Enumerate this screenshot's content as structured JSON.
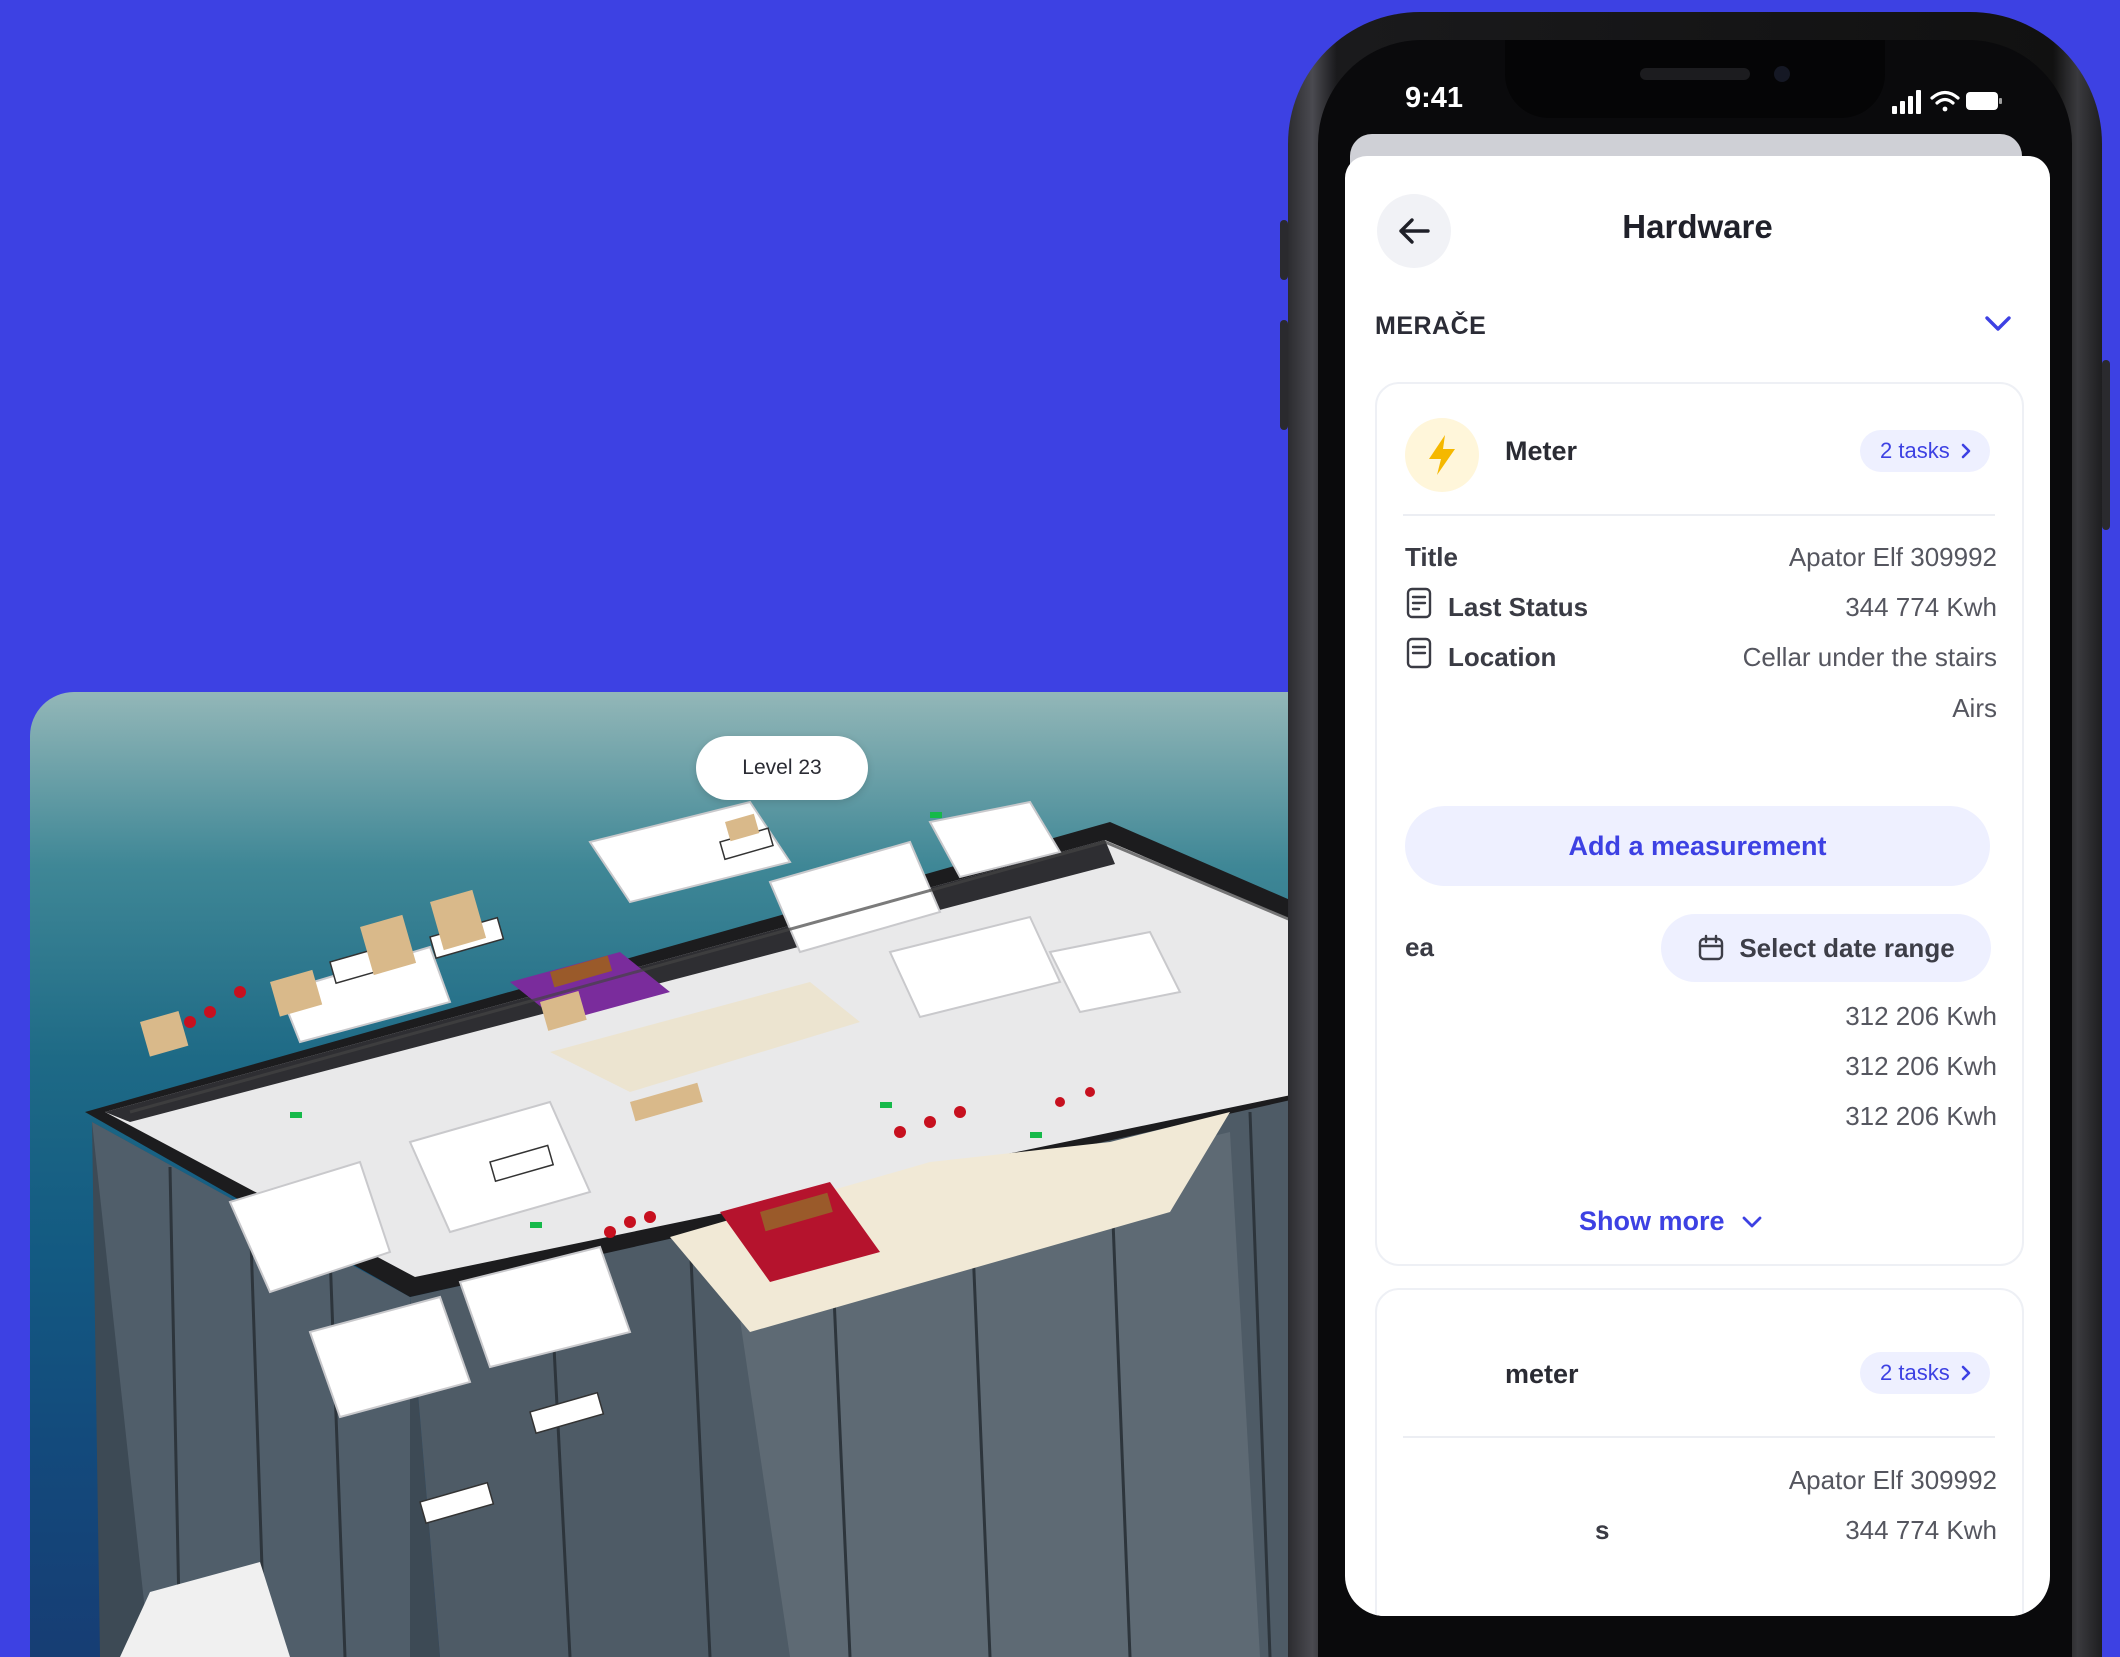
{
  "status_bar": {
    "time": "9:41"
  },
  "header": {
    "title": "Hardware"
  },
  "section": {
    "label": "MERAČE"
  },
  "meter_card": {
    "name": "Meter",
    "tasks": "2 tasks",
    "rows": [
      {
        "label": "Title",
        "value": "Apator Elf 309992"
      },
      {
        "label": "Last Status",
        "value": "344 774 Kwh"
      },
      {
        "label": "Location",
        "value": "Cellar under the stairs"
      },
      {
        "label": "",
        "value": "Airs"
      }
    ],
    "add_measurement": "Add a measurement",
    "area_label": "ea",
    "date_range": "Select date range",
    "readings": [
      "312 206 Kwh",
      "312 206 Kwh",
      "312 206 Kwh"
    ],
    "show_more": "Show more"
  },
  "meter_card_2": {
    "name": "meter",
    "tasks": "2 tasks",
    "rows": [
      {
        "label": "",
        "value": "Apator Elf 309992"
      },
      {
        "label": "s",
        "value": "344 774 Kwh"
      }
    ]
  },
  "map": {
    "level": "Level 23"
  },
  "colors": {
    "background": "#3d41e3",
    "accent": "#3d41e3",
    "bolt": "#f5b800",
    "pill_bg": "#eef0ff"
  },
  "icons": [
    "back-arrow-icon",
    "chevron-down-icon",
    "lightning-bolt-icon",
    "chevron-right-icon",
    "document-icon",
    "calendar-icon",
    "signal-icon",
    "wifi-icon",
    "battery-icon"
  ]
}
